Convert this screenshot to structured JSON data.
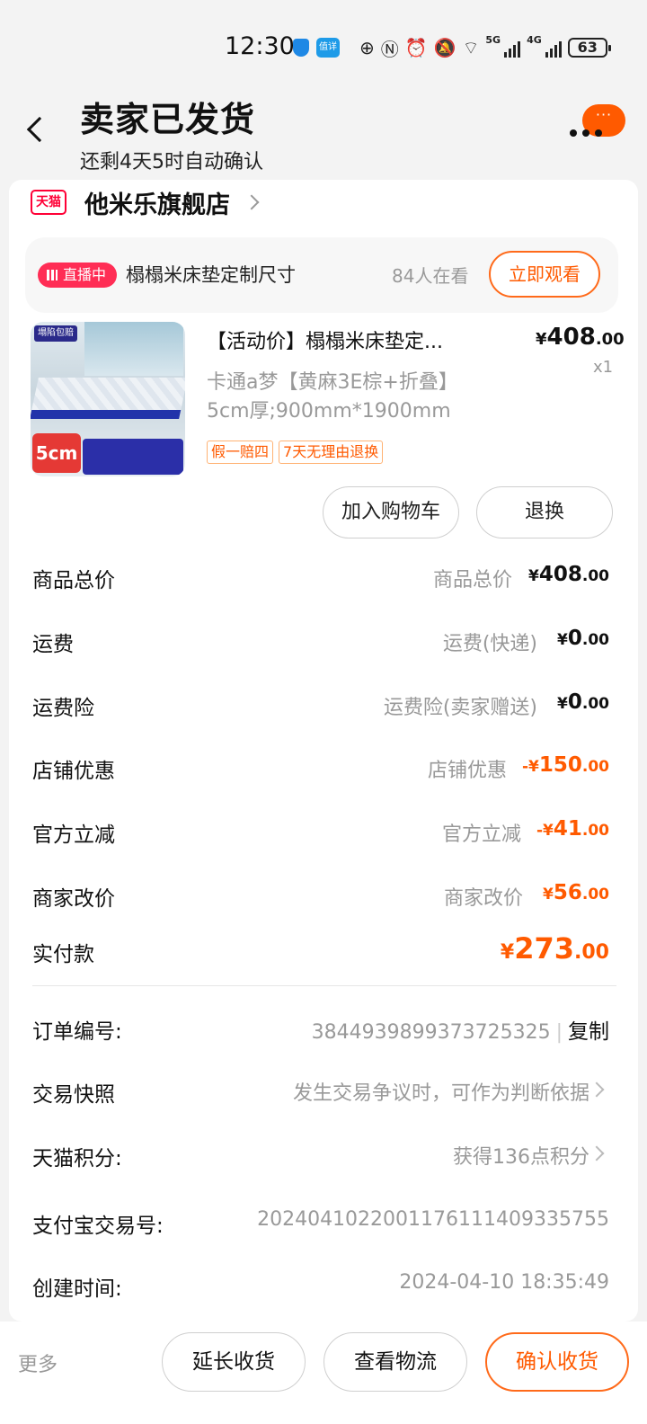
{
  "status_bar": {
    "time": "12:30",
    "app_badge": "值详",
    "network_1": "5G",
    "network_2": "4G",
    "battery": "63"
  },
  "header": {
    "title": "卖家已发货",
    "subtitle": "还剩4天5时自动确认",
    "menu_dots": "···"
  },
  "store": {
    "badge": "天猫",
    "name": "他米乐旗舰店"
  },
  "live": {
    "badge": "直播中",
    "title": "榻榻米床垫定制尺寸",
    "viewers": "84人在看",
    "watch_label": "立即观看"
  },
  "product": {
    "thumb_tag": "塌陷包赔",
    "thumb_size": "5cm",
    "title": "【活动价】榻榻米床垫定...",
    "price_currency": "¥",
    "price_int": "408",
    "price_dec": ".00",
    "quantity": "x1",
    "spec_line1": "卡通a梦【黄麻3E棕+折叠】",
    "spec_line2": "5cm厚;900mm*1900mm",
    "tags": [
      "假一赔四",
      "7天无理由退换"
    ],
    "add_cart_label": "加入购物车",
    "return_label": "退换"
  },
  "price_rows": [
    {
      "label": "商品总价",
      "sub": "商品总价",
      "prefix": "",
      "cur": "¥",
      "int": "408",
      "dec": ".00",
      "highlight": false
    },
    {
      "label": "运费",
      "sub": "运费(快递)",
      "prefix": "",
      "cur": "¥",
      "int": "0",
      "dec": ".00",
      "highlight": false
    },
    {
      "label": "运费险",
      "sub": "运费险(卖家赠送)",
      "prefix": "",
      "cur": "¥",
      "int": "0",
      "dec": ".00",
      "highlight": false
    },
    {
      "label": "店铺优惠",
      "sub": "店铺优惠",
      "prefix": "-",
      "cur": "¥",
      "int": "150",
      "dec": ".00",
      "highlight": true
    },
    {
      "label": "官方立减",
      "sub": "官方立减",
      "prefix": "-",
      "cur": "¥",
      "int": "41",
      "dec": ".00",
      "highlight": true
    },
    {
      "label": "商家改价",
      "sub": "商家改价",
      "prefix": "",
      "cur": "¥",
      "int": "56",
      "dec": ".00",
      "highlight": true
    }
  ],
  "total": {
    "label": "实付款",
    "cur": "¥",
    "int": "273",
    "dec": ".00"
  },
  "order_info": {
    "order_no_label": "订单编号:",
    "order_no": "3844939899373725325",
    "copy_label": "复制",
    "snapshot_label": "交易快照",
    "snapshot_value": "发生交易争议时，可作为判断依据",
    "points_label": "天猫积分:",
    "points_value": "获得136点积分",
    "alipay_label": "支付宝交易号:",
    "alipay_value": "2024041022001176111409335755",
    "created_label": "创建时间:",
    "created_value": "2024-04-10 18:35:49"
  },
  "bottom_bar": {
    "more": "更多",
    "extend_label": "延长收货",
    "logistics_label": "查看物流",
    "confirm_label": "确认收货"
  },
  "colors": {
    "accent": "#ff5a00",
    "tmall": "#ff0036",
    "live": "#ff2d55"
  }
}
